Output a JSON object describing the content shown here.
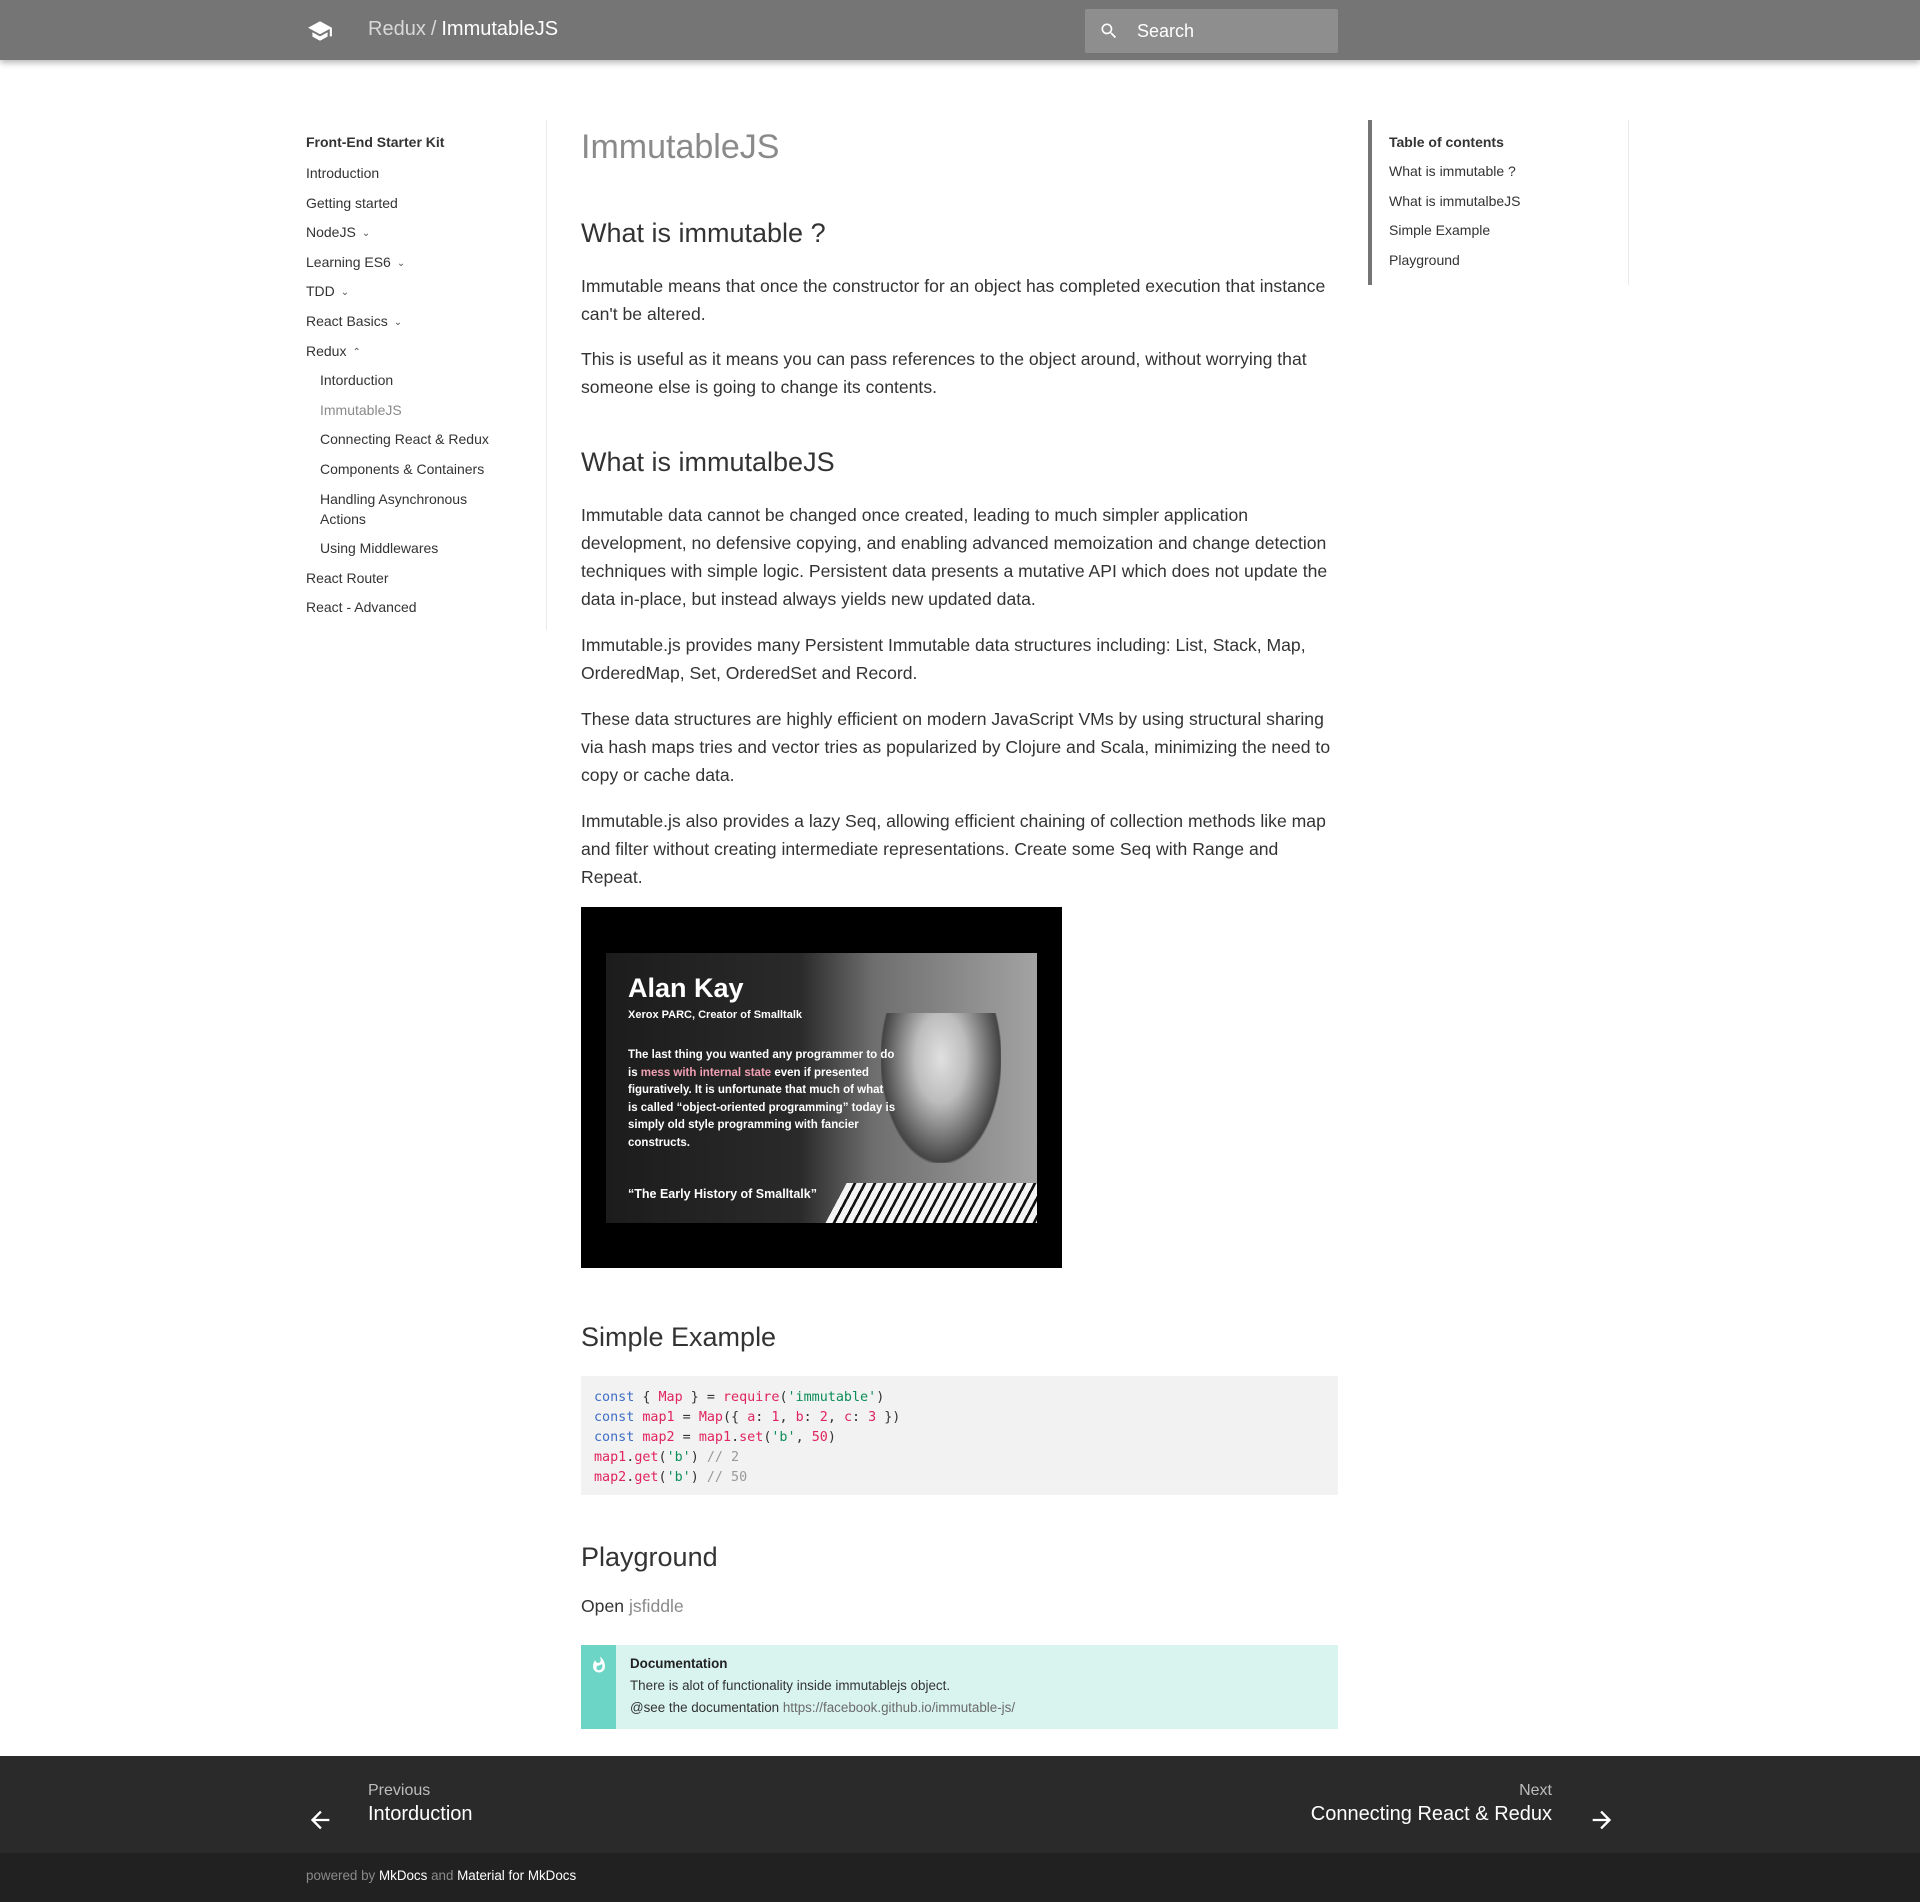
{
  "header": {
    "section": "Redux",
    "separator": "/",
    "page": "ImmutableJS",
    "search_placeholder": "Search",
    "logo_icon": "graduation-cap-icon",
    "color": "#757575"
  },
  "nav": {
    "title": "Front-End Starter Kit",
    "items": [
      {
        "label": "Introduction",
        "expandable": false
      },
      {
        "label": "Getting started",
        "expandable": false
      },
      {
        "label": "NodeJS",
        "expandable": true,
        "expanded": false
      },
      {
        "label": "Learning ES6",
        "expandable": true,
        "expanded": false
      },
      {
        "label": "TDD",
        "expandable": true,
        "expanded": false
      },
      {
        "label": "React Basics",
        "expandable": true,
        "expanded": false
      },
      {
        "label": "Redux",
        "expandable": true,
        "expanded": true
      },
      {
        "label": "Intorduction",
        "child": true
      },
      {
        "label": "ImmutableJS",
        "child": true,
        "active": true
      },
      {
        "label": "Connecting React & Redux",
        "child": true
      },
      {
        "label": "Components & Containers",
        "child": true
      },
      {
        "label": "Handling Asynchronous",
        "child": true
      },
      {
        "label": "Actions",
        "child": true
      },
      {
        "label": "Using Middlewares",
        "child": true
      },
      {
        "label": "React Router",
        "expandable": false
      },
      {
        "label": "React - Advanced",
        "expandable": false
      }
    ]
  },
  "content": {
    "title": "ImmutableJS",
    "sections": [
      {
        "heading": "What is immutable ?",
        "paragraphs": [
          "Immutable means that once the constructor for an object has completed execution that instance can't be altered.",
          "This is useful as it means you can pass references to the object around, without worrying that someone else is going to change its contents."
        ]
      },
      {
        "heading": "What is immutalbeJS",
        "paragraphs": [
          "Immutable data cannot be changed once created, leading to much simpler application development, no defensive copying, and enabling advanced memoization and change detection techniques with simple logic. Persistent data presents a mutative API which does not update the data in-place, but instead always yields new updated data.",
          "Immutable.js provides many Persistent Immutable data structures including: List, Stack, Map, OrderedMap, Set, OrderedSet and Record.",
          "These data structures are highly efficient on modern JavaScript VMs by using structural sharing via hash maps tries and vector tries as popularized by Clojure and Scala, minimizing the need to copy or cache data.",
          "Immutable.js also provides a lazy Seq, allowing efficient chaining of collection methods like map and filter without creating intermediate representations. Create some Seq with Range and Repeat."
        ]
      },
      {
        "heading": "Simple Example"
      },
      {
        "heading": "Playground"
      }
    ],
    "image": {
      "name": "Alan Kay",
      "subtitle": "Xerox PARC, Creator of Smalltalk",
      "quote_pre": "The last thing you wanted any programmer to do is ",
      "quote_highlight": "mess with internal state",
      "quote_post": " even if presented figuratively. It is unfortunate that much of what is called “object-oriented programming” today is simply old style programming with fancier constructs.",
      "source": "“The Early History of Smalltalk”",
      "highlight_color": "#f19fb2"
    },
    "code_lines": [
      [
        [
          "kw",
          "const"
        ],
        [
          "p",
          " { "
        ],
        [
          "fn",
          "Map"
        ],
        [
          "p",
          " } = "
        ],
        [
          "fn",
          "require"
        ],
        [
          "p",
          "("
        ],
        [
          "str",
          "'immutable'"
        ],
        [
          "p",
          ")"
        ]
      ],
      [
        [
          "kw",
          "const"
        ],
        [
          "p",
          " "
        ],
        [
          "fn",
          "map1"
        ],
        [
          "p",
          " = "
        ],
        [
          "fn",
          "Map"
        ],
        [
          "p",
          "({ "
        ],
        [
          "fn",
          "a"
        ],
        [
          "p",
          ": "
        ],
        [
          "num",
          "1"
        ],
        [
          "p",
          ", "
        ],
        [
          "fn",
          "b"
        ],
        [
          "p",
          ": "
        ],
        [
          "num",
          "2"
        ],
        [
          "p",
          ", "
        ],
        [
          "fn",
          "c"
        ],
        [
          "p",
          ": "
        ],
        [
          "num",
          "3"
        ],
        [
          "p",
          " })"
        ]
      ],
      [
        [
          "kw",
          "const"
        ],
        [
          "p",
          " "
        ],
        [
          "fn",
          "map2"
        ],
        [
          "p",
          " = "
        ],
        [
          "fn",
          "map1"
        ],
        [
          "p",
          "."
        ],
        [
          "fn",
          "set"
        ],
        [
          "p",
          "("
        ],
        [
          "str",
          "'b'"
        ],
        [
          "p",
          ", "
        ],
        [
          "num",
          "50"
        ],
        [
          "p",
          ")"
        ]
      ],
      [
        [
          "fn",
          "map1"
        ],
        [
          "p",
          "."
        ],
        [
          "fn",
          "get"
        ],
        [
          "p",
          "("
        ],
        [
          "str",
          "'b'"
        ],
        [
          "p",
          ") "
        ],
        [
          "cm",
          "// 2"
        ]
      ],
      [
        [
          "fn",
          "map2"
        ],
        [
          "p",
          "."
        ],
        [
          "fn",
          "get"
        ],
        [
          "p",
          "("
        ],
        [
          "str",
          "'b'"
        ],
        [
          "p",
          ") "
        ],
        [
          "cm",
          "// 50"
        ]
      ]
    ],
    "playground": {
      "prefix": "Open",
      "link": "jsfiddle"
    },
    "admonition": {
      "title": "Documentation",
      "line1": "There is alot of functionality inside immutablejs object.",
      "line2_prefix": "@see the documentation",
      "url": "https://facebook.github.io/immutable-js/",
      "icon": "flame-icon",
      "color": "#6dd5c6"
    }
  },
  "toc": {
    "title": "Table of contents",
    "items": [
      "What is immutable ?",
      "What is immutalbeJS",
      "Simple Example",
      "Playground"
    ]
  },
  "footer": {
    "prev_label": "Previous",
    "prev_title": "Intorduction",
    "next_label": "Next",
    "next_title": "Connecting React & Redux",
    "powered_prefix": "powered by",
    "mkdocs": "MkDocs",
    "and": "and",
    "material": "Material for MkDocs"
  }
}
